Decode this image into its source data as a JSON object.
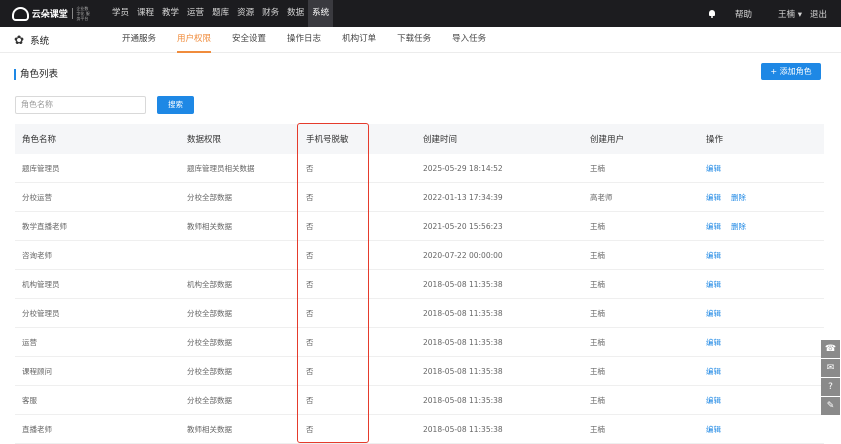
{
  "brand": {
    "logo_text": "云朵课堂",
    "logo_sub": "企业数字化 服务平台"
  },
  "topnav": {
    "items": [
      "学员",
      "课程",
      "教学",
      "运营",
      "题库",
      "资源",
      "财务",
      "数据",
      "系统"
    ],
    "active": "系统"
  },
  "top_right": {
    "help": "帮助",
    "user": "王楠 ▾",
    "logout": "退出"
  },
  "subbar": {
    "title": "系统",
    "tabs": [
      "开通服务",
      "用户权限",
      "安全设置",
      "操作日志",
      "机构订单",
      "下载任务",
      "导入任务"
    ],
    "active_tab": "用户权限"
  },
  "section": {
    "title": "角色列表",
    "add_button": "+ 添加角色"
  },
  "search": {
    "placeholder": "角色名称",
    "button": "搜索"
  },
  "table": {
    "headers": [
      "角色名称",
      "数据权限",
      "手机号脱敏",
      "创建时间",
      "创建用户",
      "操作"
    ],
    "rows": [
      {
        "name": "题库管理员",
        "perm": "题库管理员相关数据",
        "mask": "否",
        "time": "2025-05-29 18:14:52",
        "creator": "王楠",
        "actions": [
          "编辑"
        ]
      },
      {
        "name": "分校运营",
        "perm": "分校全部数据",
        "mask": "否",
        "time": "2022-01-13 17:34:39",
        "creator": "高老师",
        "actions": [
          "编辑",
          "删除"
        ]
      },
      {
        "name": "教学直播老师",
        "perm": "教师相关数据",
        "mask": "否",
        "time": "2021-05-20 15:56:23",
        "creator": "王楠",
        "actions": [
          "编辑",
          "删除"
        ]
      },
      {
        "name": "咨询老师",
        "perm": "",
        "mask": "否",
        "time": "2020-07-22 00:00:00",
        "creator": "王楠",
        "actions": [
          "编辑"
        ]
      },
      {
        "name": "机构管理员",
        "perm": "机构全部数据",
        "mask": "否",
        "time": "2018-05-08 11:35:38",
        "creator": "王楠",
        "actions": [
          "编辑"
        ]
      },
      {
        "name": "分校管理员",
        "perm": "分校全部数据",
        "mask": "否",
        "time": "2018-05-08 11:35:38",
        "creator": "王楠",
        "actions": [
          "编辑"
        ]
      },
      {
        "name": "运营",
        "perm": "分校全部数据",
        "mask": "否",
        "time": "2018-05-08 11:35:38",
        "creator": "王楠",
        "actions": [
          "编辑"
        ]
      },
      {
        "name": "课程顾问",
        "perm": "分校全部数据",
        "mask": "否",
        "time": "2018-05-08 11:35:38",
        "creator": "王楠",
        "actions": [
          "编辑"
        ]
      },
      {
        "name": "客服",
        "perm": "分校全部数据",
        "mask": "否",
        "time": "2018-05-08 11:35:38",
        "creator": "王楠",
        "actions": [
          "编辑"
        ]
      },
      {
        "name": "直播老师",
        "perm": "教师相关数据",
        "mask": "否",
        "time": "2018-05-08 11:35:38",
        "creator": "王楠",
        "actions": [
          "编辑"
        ]
      }
    ]
  },
  "side_tools": [
    "phone-icon",
    "mail-icon",
    "help-icon",
    "edit-icon"
  ],
  "colors": {
    "accent": "#1e88e5",
    "active_tab": "#f08c3c",
    "highlight": "#e53b2c",
    "topbar": "#1c1c1f"
  }
}
